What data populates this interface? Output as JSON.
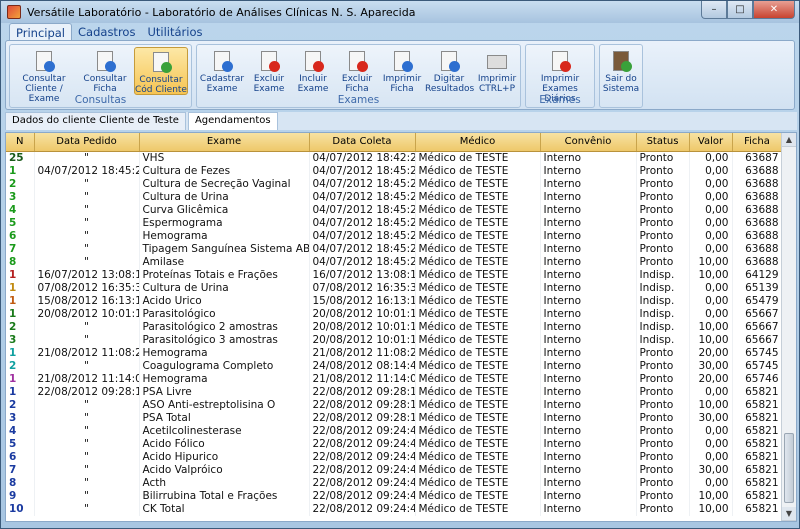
{
  "window": {
    "title": "Versátile Laboratório - Laboratório de Análises Clínicas N. S. Aparecida",
    "controls": [
      "–",
      "□",
      "✕"
    ]
  },
  "menu_tabs": [
    "Principal",
    "Cadastros",
    "Utilitários"
  ],
  "ribbon": {
    "groups": [
      {
        "label": "Consultas",
        "buttons": [
          "Consultar Cliente / Exame",
          "Consultar Ficha",
          "Consultar Cód Cliente"
        ]
      },
      {
        "label": "Exames",
        "buttons": [
          "Cadastrar Exame",
          "Excluir Exame",
          "Incluir Exame",
          "Excluir Ficha",
          "Imprimir Ficha",
          "Digitar Resultados",
          "Imprimir CTRL+P"
        ]
      },
      {
        "label": "Exames",
        "buttons": [
          "Imprimir Exames Diários"
        ]
      },
      {
        "label": "",
        "buttons": [
          "Sair do Sistema"
        ]
      }
    ]
  },
  "subtabs": [
    "Dados do cliente Cliente de Teste",
    "Agendamentos"
  ],
  "table": {
    "columns": [
      "N",
      "Data Pedido",
      "Exame",
      "Data Coleta",
      "Médico",
      "Convênio",
      "Status",
      "Valor",
      "Ficha"
    ],
    "rows": [
      [
        "25",
        "\"",
        "VHS",
        "04/07/2012 18:42:23",
        "Médico de TESTE",
        "Interno",
        "Pronto",
        "0,00",
        "63687"
      ],
      [
        "1",
        "04/07/2012 18:45:22",
        "Cultura de Fezes",
        "04/07/2012 18:45:22",
        "Médico de TESTE",
        "Interno",
        "Pronto",
        "0,00",
        "63688"
      ],
      [
        "2",
        "\"",
        "Cultura de Secreção Vaginal",
        "04/07/2012 18:45:22",
        "Médico de TESTE",
        "Interno",
        "Pronto",
        "0,00",
        "63688"
      ],
      [
        "3",
        "\"",
        "Cultura de Urina",
        "04/07/2012 18:45:22",
        "Médico de TESTE",
        "Interno",
        "Pronto",
        "0,00",
        "63688"
      ],
      [
        "4",
        "\"",
        "Curva Glicêmica",
        "04/07/2012 18:45:22",
        "Médico de TESTE",
        "Interno",
        "Pronto",
        "0,00",
        "63688"
      ],
      [
        "5",
        "\"",
        "Espermograma",
        "04/07/2012 18:45:22",
        "Médico de TESTE",
        "Interno",
        "Pronto",
        "0,00",
        "63688"
      ],
      [
        "6",
        "\"",
        "Hemograma",
        "04/07/2012 18:45:23",
        "Médico de TESTE",
        "Interno",
        "Pronto",
        "0,00",
        "63688"
      ],
      [
        "7",
        "\"",
        "Tipagem Sanguínea Sistema ABO",
        "04/07/2012 18:45:26",
        "Médico de TESTE",
        "Interno",
        "Pronto",
        "0,00",
        "63688"
      ],
      [
        "8",
        "\"",
        "Amilase",
        "04/07/2012 18:45:26",
        "Médico de TESTE",
        "Interno",
        "Pronto",
        "10,00",
        "63688"
      ],
      [
        "1",
        "16/07/2012 13:08:16",
        "Proteínas Totais e Frações",
        "16/07/2012 13:08:16",
        "Médico de TESTE",
        "Interno",
        "Indisp.",
        "10,00",
        "64129"
      ],
      [
        "1",
        "07/08/2012 16:35:32",
        "Cultura de Urina",
        "07/08/2012 16:35:32",
        "Médico de TESTE",
        "Interno",
        "Indisp.",
        "0,00",
        "65139"
      ],
      [
        "1",
        "15/08/2012 16:13:11",
        "Acido Urico",
        "15/08/2012 16:13:11",
        "Médico de TESTE",
        "Interno",
        "Indisp.",
        "0,00",
        "65479"
      ],
      [
        "1",
        "20/08/2012 10:01:12",
        "Parasitológico",
        "20/08/2012 10:01:12",
        "Médico de TESTE",
        "Interno",
        "Indisp.",
        "0,00",
        "65667"
      ],
      [
        "2",
        "\"",
        "Parasitológico 2 amostras",
        "20/08/2012 10:01:12",
        "Médico de TESTE",
        "Interno",
        "Indisp.",
        "10,00",
        "65667"
      ],
      [
        "3",
        "\"",
        "Parasitológico 3 amostras",
        "20/08/2012 10:01:12",
        "Médico de TESTE",
        "Interno",
        "Indisp.",
        "10,00",
        "65667"
      ],
      [
        "1",
        "21/08/2012 11:08:21",
        "Hemograma",
        "21/08/2012 11:08:21",
        "Médico de TESTE",
        "Interno",
        "Pronto",
        "20,00",
        "65745"
      ],
      [
        "2",
        "\"",
        "Coagulograma Completo",
        "24/08/2012 08:14:43",
        "Médico de TESTE",
        "Interno",
        "Pronto",
        "30,00",
        "65745"
      ],
      [
        "1",
        "21/08/2012 11:14:05",
        "Hemograma",
        "21/08/2012 11:14:05",
        "Médico de TESTE",
        "Interno",
        "Pronto",
        "20,00",
        "65746"
      ],
      [
        "1",
        "22/08/2012 09:28:14",
        "PSA Livre",
        "22/08/2012 09:28:14",
        "Médico de TESTE",
        "Interno",
        "Pronto",
        "0,00",
        "65821"
      ],
      [
        "2",
        "\"",
        "ASO Anti-estreptolisina O",
        "22/08/2012 09:28:14",
        "Médico de TESTE",
        "Interno",
        "Pronto",
        "10,00",
        "65821"
      ],
      [
        "3",
        "\"",
        "PSA Total",
        "22/08/2012 09:28:14",
        "Médico de TESTE",
        "Interno",
        "Pronto",
        "30,00",
        "65821"
      ],
      [
        "4",
        "\"",
        "Acetilcolinesterase",
        "22/08/2012 09:24:45",
        "Médico de TESTE",
        "Interno",
        "Pronto",
        "0,00",
        "65821"
      ],
      [
        "5",
        "\"",
        "Acido Fólico",
        "22/08/2012 09:24:45",
        "Médico de TESTE",
        "Interno",
        "Pronto",
        "0,00",
        "65821"
      ],
      [
        "6",
        "\"",
        "Acido Hipurico",
        "22/08/2012 09:24:46",
        "Médico de TESTE",
        "Interno",
        "Pronto",
        "0,00",
        "65821"
      ],
      [
        "7",
        "\"",
        "Acido Valpróico",
        "22/08/2012 09:24:46",
        "Médico de TESTE",
        "Interno",
        "Pronto",
        "30,00",
        "65821"
      ],
      [
        "8",
        "\"",
        "Acth",
        "22/08/2012 09:24:46",
        "Médico de TESTE",
        "Interno",
        "Pronto",
        "0,00",
        "65821"
      ],
      [
        "9",
        "\"",
        "Bilirrubina Total e Frações",
        "22/08/2012 09:24:46",
        "Médico de TESTE",
        "Interno",
        "Pronto",
        "10,00",
        "65821"
      ],
      [
        "10",
        "\"",
        "CK Total",
        "22/08/2012 09:24:46",
        "Médico de TESTE",
        "Interno",
        "Pronto",
        "10,00",
        "65821"
      ]
    ],
    "n_colors": [
      "#1a5a1a",
      "#1a9a1a",
      "#1a9a1a",
      "#1a9a1a",
      "#1a9a1a",
      "#1a9a1a",
      "#1a9a1a",
      "#1a9a1a",
      "#1a9a1a",
      "#b42020",
      "#c08a10",
      "#c05a10",
      "#1a7a1a",
      "#1a7a1a",
      "#1a7a1a",
      "#10a0a0",
      "#10a0a0",
      "#a030a0",
      "#1a3aa0",
      "#1a3aa0",
      "#1a3aa0",
      "#1a3aa0",
      "#1a3aa0",
      "#1a3aa0",
      "#1a3aa0",
      "#1a3aa0",
      "#1a3aa0",
      "#1a3aa0"
    ]
  }
}
